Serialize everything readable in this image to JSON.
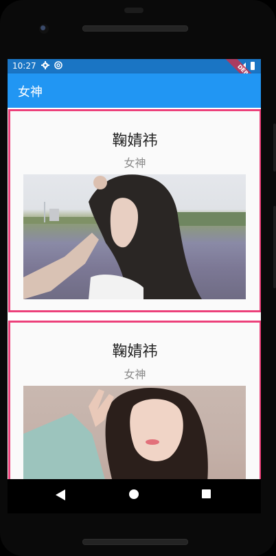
{
  "statusbar": {
    "time": "10:27",
    "debug_banner": "DEBUG"
  },
  "appbar": {
    "title": "女神"
  },
  "cards": [
    {
      "title": "鞠婧祎",
      "subtitle": "女神"
    },
    {
      "title": "鞠婧祎",
      "subtitle": "女神"
    }
  ],
  "colors": {
    "appbar": "#2196f3",
    "statusbar": "#1a75c4",
    "card_border": "#ec407a"
  },
  "icons": {
    "status": [
      "gear-icon",
      "sync-icon",
      "signal-icon",
      "battery-icon"
    ],
    "nav": [
      "back-icon",
      "home-icon",
      "recents-icon"
    ]
  }
}
